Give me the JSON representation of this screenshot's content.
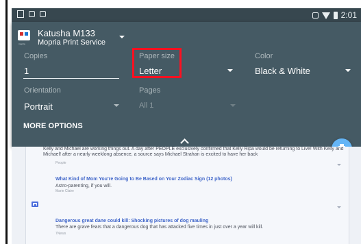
{
  "status_bar": {
    "time": "2:01"
  },
  "printer": {
    "name": "Katusha M133",
    "service": "Mopria Print Service",
    "logo_text": "mopria"
  },
  "settings": {
    "copies": {
      "label": "Copies",
      "value": "1"
    },
    "paper_size": {
      "label": "Paper size",
      "value": "Letter"
    },
    "color": {
      "label": "Color",
      "value": "Black & White"
    },
    "orientation": {
      "label": "Orientation",
      "value": "Portrait"
    },
    "pages": {
      "label": "Pages",
      "value": "All 1"
    },
    "more_options": "MORE OPTIONS"
  },
  "background_page": {
    "story_1": {
      "text": "Kelly and Michael are working things out. A day after PEOPLE exclusively confirmed that Kelly Ripa would be returning to Live! With Kelly and Michael! after a nearly weeklong absence, a source says Michael Strahan is excited to have her back",
      "source": "People"
    },
    "story_2": {
      "title": "What Kind of Mom You're Going to Be Based on Your Zodiac Sign (12 photos)",
      "text": "Astro-parenting, if you will.",
      "source": "Marie Claire"
    },
    "story_3": {
      "title": "Dangerous great dane could kill: Shocking pictures of dog mauling",
      "text": "There are grave fears that a dangerous dog that has attacked five times in just over a year will kill.",
      "source": "7News"
    }
  },
  "colors": {
    "status_bar": "#37474f",
    "print_panel": "#455a64",
    "highlight": "#ff1020",
    "fab": "#64b5f6",
    "link": "#3f65c9"
  },
  "icons": {
    "printer_logo": "mopria-printer-logo-icon",
    "dropdown": "chevron-down-icon",
    "collapse": "chevron-up-icon",
    "print_button": "print-icon",
    "thumbnail": "image-thumbnail-icon"
  }
}
